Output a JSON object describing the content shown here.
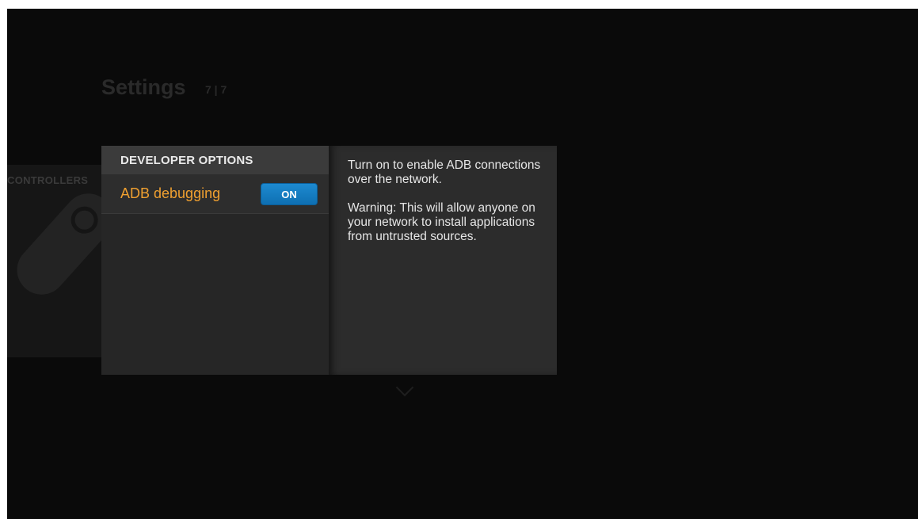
{
  "background": {
    "title": "Settings",
    "count": "7 | 7",
    "tile_label": "CONTROLLERS"
  },
  "panel": {
    "header": "DEVELOPER OPTIONS",
    "setting": {
      "label": "ADB debugging",
      "toggle_state": "ON"
    }
  },
  "help": {
    "paragraph1": "Turn on to enable ADB connections over the network.",
    "paragraph2": "Warning: This will allow anyone on your network to install applications from untrusted sources."
  },
  "colors": {
    "accent": "#f0a030",
    "toggle_on": "#1b86cb",
    "background": "#0a0a0a"
  }
}
